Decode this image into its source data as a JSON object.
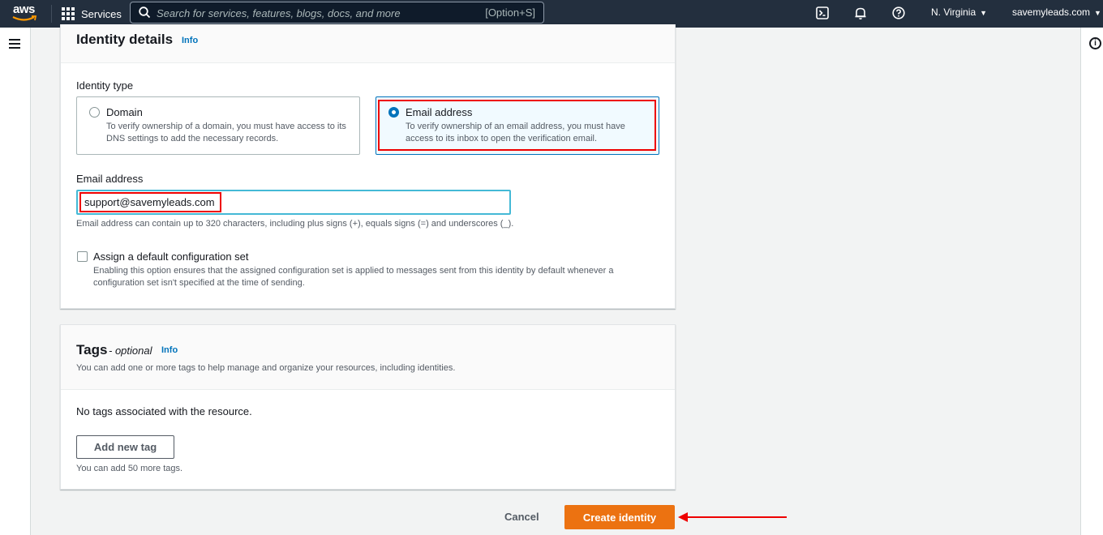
{
  "topnav": {
    "logo": "aws",
    "services_label": "Services",
    "search_placeholder": "Search for services, features, blogs, docs, and more",
    "search_shortcut": "[Option+S]",
    "region": "N. Virginia",
    "account": "savemyleads.com",
    "icons": [
      "cloudshell-icon",
      "bell-icon",
      "help-icon"
    ]
  },
  "identity_details": {
    "title": "Identity details",
    "info": "Info",
    "identity_type_label": "Identity type",
    "options": [
      {
        "title": "Domain",
        "desc": "To verify ownership of a domain, you must have access to its DNS settings to add the necessary records.",
        "selected": false
      },
      {
        "title": "Email address",
        "desc": "To verify ownership of an email address, you must have access to its inbox to open the verification email.",
        "selected": true
      }
    ],
    "email_label": "Email address",
    "email_value": "support@savemyleads.com",
    "email_hint": "Email address can contain up to 320 characters, including plus signs (+), equals signs (=) and underscores (_).",
    "config_set_label": "Assign a default configuration set",
    "config_set_desc": "Enabling this option ensures that the assigned configuration set is applied to messages sent from this identity by default whenever a configuration set isn't specified at the time of sending."
  },
  "tags": {
    "title": "Tags",
    "optional": "- optional",
    "info": "Info",
    "desc": "You can add one or more tags to help manage and organize your resources, including identities.",
    "empty": "No tags associated with the resource.",
    "add_button": "Add new tag",
    "limit_hint": "You can add 50 more tags."
  },
  "footer": {
    "cancel": "Cancel",
    "create": "Create identity"
  },
  "colors": {
    "nav_bg": "#232f3e",
    "primary": "#ec7211",
    "link": "#0073bb",
    "annotation": "#e00000"
  }
}
